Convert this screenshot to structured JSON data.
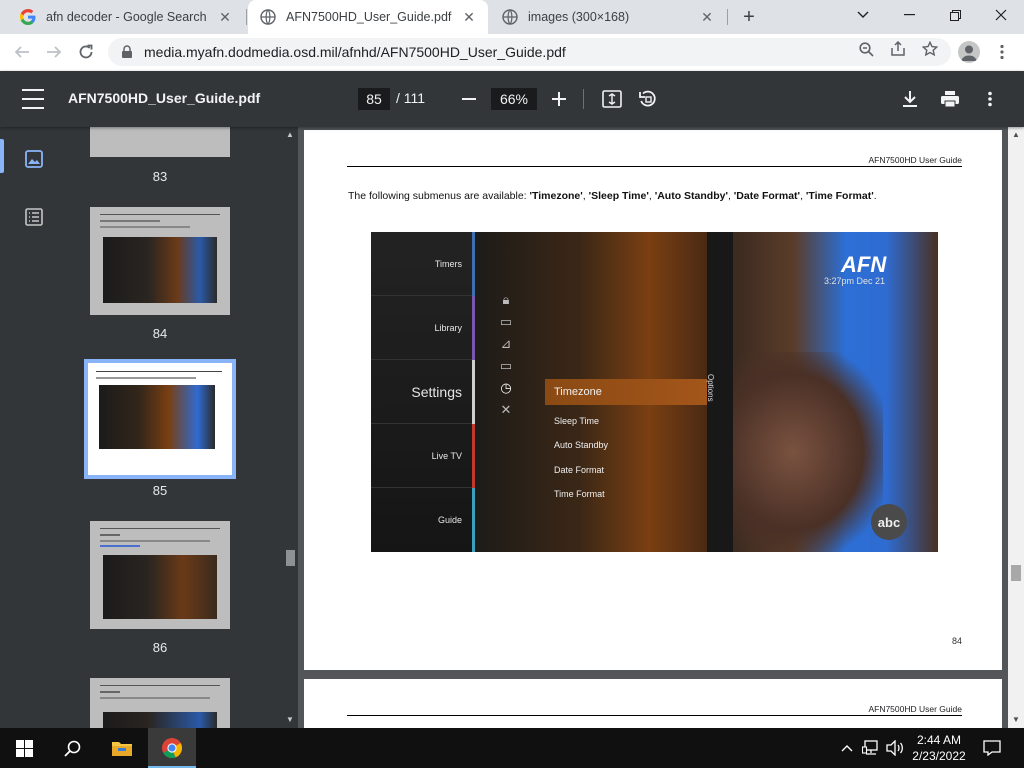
{
  "tabs": [
    {
      "title": "afn decoder - Google Search",
      "favicon": "google-icon",
      "active": false
    },
    {
      "title": "AFN7500HD_User_Guide.pdf",
      "favicon": "globe-icon",
      "active": true
    },
    {
      "title": "images (300×168)",
      "favicon": "globe-icon",
      "active": false
    }
  ],
  "toolbar": {
    "url": "media.myafn.dodmedia.osd.mil/afnhd/AFN7500HD_User_Guide.pdf"
  },
  "pdf": {
    "title": "AFN7500HD_User_Guide.pdf",
    "current_page": "85",
    "total_pages": "/ 111",
    "zoom": "66%"
  },
  "thumbnails": [
    {
      "page": "83",
      "selected": false
    },
    {
      "page": "84",
      "selected": false
    },
    {
      "page": "85",
      "selected": true
    },
    {
      "page": "86",
      "selected": false
    }
  ],
  "page": {
    "header": "AFN7500HD User Guide",
    "intro": "The following submenus are available: ",
    "items": [
      "'Timezone'",
      "'Sleep Time'",
      "'Auto Standby'",
      "'Date Format'",
      "'Time Format'"
    ],
    "number": "84",
    "next_header": "AFN7500HD User Guide"
  },
  "tv_screen": {
    "left_menu": [
      "Timers",
      "Library",
      "Settings",
      "Live TV",
      "Guide"
    ],
    "submenu": [
      "Timezone",
      "Sleep Time",
      "Auto Standby",
      "Date Format",
      "Time Format"
    ],
    "options_label": "Options",
    "logo": "AFN",
    "time": "3:27pm  Dec 21",
    "channel_bug": "abc"
  },
  "taskbar": {
    "time": "2:44 AM",
    "date": "2/23/2022"
  },
  "colors": {
    "pdf_toolbar": "#323639",
    "viewer_bg": "#525659",
    "selection": "#8ab4f8",
    "taskbar": "#101010"
  }
}
